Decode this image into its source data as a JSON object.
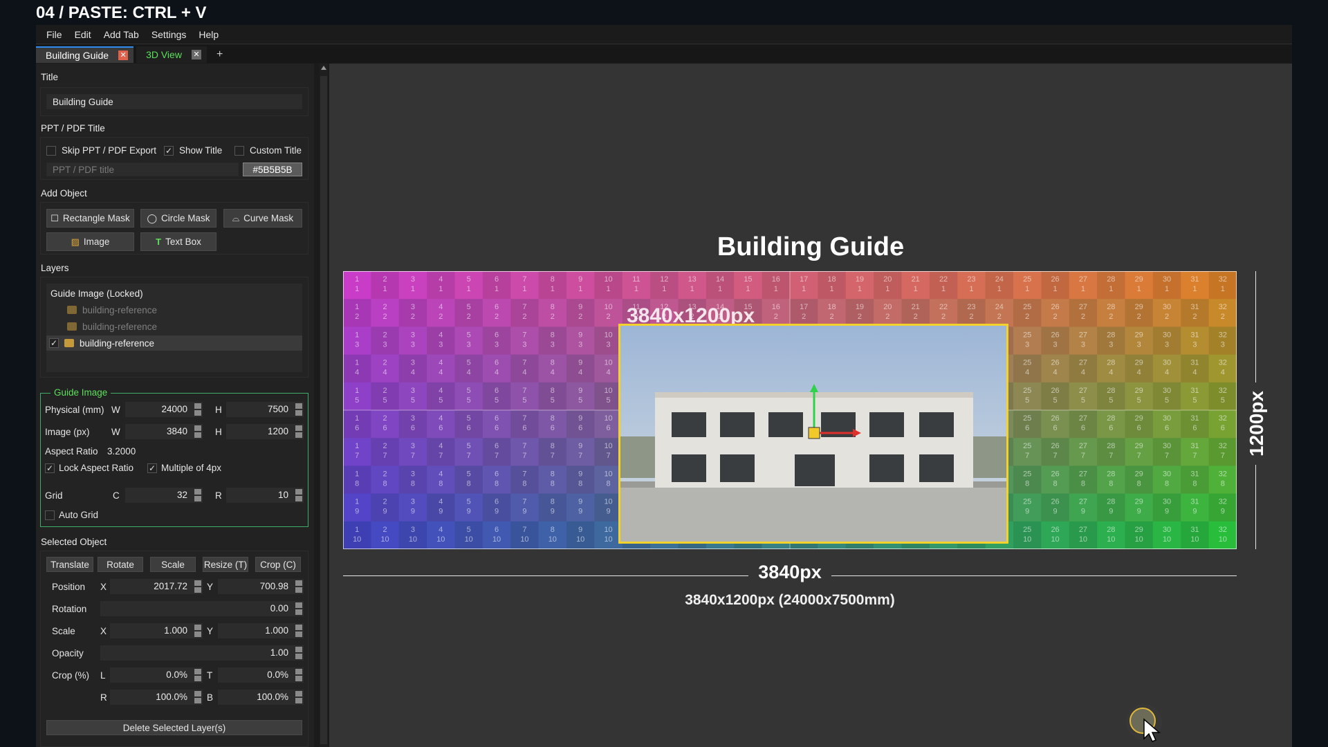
{
  "headline": "04 / PASTE: CTRL + V",
  "menu": [
    "File",
    "Edit",
    "Add Tab",
    "Settings",
    "Help"
  ],
  "tabs": [
    {
      "label": "Building Guide",
      "close": "✕"
    },
    {
      "label": "3D View",
      "close": "✕"
    }
  ],
  "tab_add": "+",
  "panel": {
    "title_section": "Title",
    "title_value": "Building Guide",
    "ppt_section": "PPT / PDF Title",
    "skip_export": "Skip PPT / PDF Export",
    "show_title": "Show Title",
    "custom_title": "Custom Title",
    "ppt_placeholder": "PPT / PDF title",
    "color_value": "#5B5B5B",
    "add_object_section": "Add Object",
    "btn_rect": "Rectangle Mask",
    "btn_circle": "Circle Mask",
    "btn_curve": "Curve Mask",
    "btn_image": "Image",
    "btn_text": "Text Box",
    "layers_section": "Layers",
    "layer_group": "Guide Image (Locked)",
    "layers": [
      "building-reference",
      "building-reference",
      "building-reference"
    ],
    "guide_legend": "Guide Image",
    "physical_label": "Physical (mm)",
    "image_px_label": "Image (px)",
    "w": "W",
    "h": "H",
    "physical_w": "24000",
    "physical_h": "7500",
    "image_w": "3840",
    "image_h": "1200",
    "aspect_label": "Aspect Ratio",
    "aspect_value": "3.2000",
    "lock_aspect": "Lock Aspect Ratio",
    "multiple4": "Multiple of 4px",
    "grid_label": "Grid",
    "c": "C",
    "r": "R",
    "grid_c": "32",
    "grid_r": "10",
    "auto_grid": "Auto Grid",
    "selected_section": "Selected Object",
    "btn_translate": "Translate",
    "btn_rotate": "Rotate",
    "btn_scale": "Scale",
    "btn_resize": "Resize (T)",
    "btn_crop": "Crop (C)",
    "position_label": "Position",
    "x": "X",
    "y": "Y",
    "pos_x": "2017.72",
    "pos_y": "700.98",
    "rotation_label": "Rotation",
    "rotation": "0.00",
    "scale_label": "Scale",
    "scale_x": "1.000",
    "scale_y": "1.000",
    "opacity_label": "Opacity",
    "opacity": "1.00",
    "crop_label": "Crop (%)",
    "l": "L",
    "t": "T",
    "b": "B",
    "crop_l": "0.0%",
    "crop_t": "0.0%",
    "crop_r": "100.0%",
    "crop_b": "100.0%",
    "delete_btn": "Delete Selected Layer(s)"
  },
  "canvas": {
    "title": "Building Guide",
    "resolution_overlay": "3840x1200px",
    "width_label": "3840px",
    "height_label": "1200px",
    "summary": "3840x1200px (24000x7500mm)",
    "grid_cols": 32,
    "grid_rows": 10
  },
  "colors": {
    "accent_green": "#5CE05C",
    "selection_yellow": "#F2D22B",
    "close_red": "#E0604A",
    "tab_blue": "#2D8CF0"
  }
}
